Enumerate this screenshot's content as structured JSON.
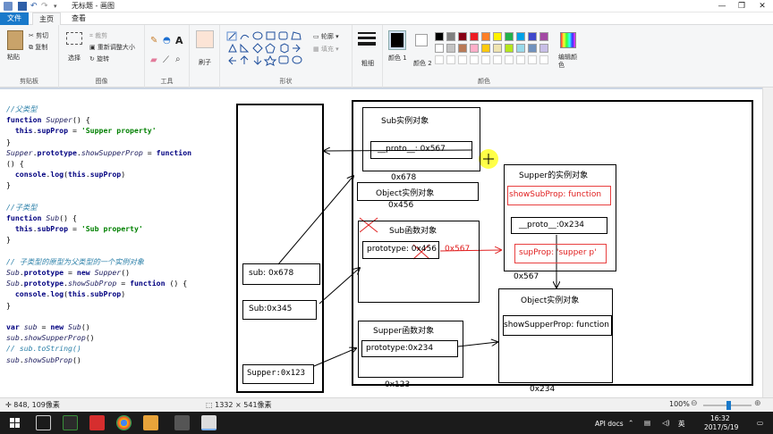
{
  "window": {
    "title": "无标题 - 画图",
    "min_glyph": "—",
    "max_glyph": "❐",
    "close_glyph": "✕"
  },
  "tabs": [
    "文件",
    "主页",
    "查看"
  ],
  "ribbon": {
    "clipboard": {
      "paste": "粘贴",
      "cut": "剪切",
      "copy": "复制",
      "label": "剪贴板"
    },
    "image": {
      "select": "选择",
      "crop": "裁剪",
      "resize": "重新调整大小",
      "rotate": "旋转",
      "label": "图像"
    },
    "tools": {
      "label": "工具"
    },
    "brushes": {
      "label": "刷子"
    },
    "shapes": {
      "outline": "轮廓",
      "fill": "填充",
      "label": "形状"
    },
    "size": {
      "label": "粗细"
    },
    "colors": {
      "color1": "颜色 1",
      "color2": "颜色 2",
      "edit": "编辑颜色",
      "label": "颜色",
      "palette_row1": [
        "#000000",
        "#7f7f7f",
        "#880015",
        "#ed1c24",
        "#ff7f27",
        "#fff200",
        "#22b14c",
        "#00a2e8",
        "#3f48cc",
        "#a349a4"
      ],
      "palette_row2": [
        "#ffffff",
        "#c3c3c3",
        "#b97a57",
        "#ffaec9",
        "#ffc90e",
        "#efe4b0",
        "#b5e61d",
        "#99d9ea",
        "#7092be",
        "#c8bfe7"
      ]
    }
  },
  "code": {
    "lines": [
      [
        [
          "cm",
          "//父类型"
        ]
      ],
      [
        [
          "kw",
          "function "
        ],
        [
          "fn",
          "Supper"
        ],
        [
          "plain",
          "() {"
        ]
      ],
      [
        [
          "plain",
          "  "
        ],
        [
          "kw",
          "this"
        ],
        [
          "plain",
          "."
        ],
        [
          "kw",
          "supProp"
        ],
        [
          "plain",
          " = "
        ],
        [
          "str",
          "'Supper property'"
        ]
      ],
      [
        [
          "plain",
          "}"
        ]
      ],
      [
        [
          "fn",
          "Supper"
        ],
        [
          "plain",
          "."
        ],
        [
          "kw",
          "prototype"
        ],
        [
          "plain",
          "."
        ],
        [
          "fn",
          "showSupperProp"
        ],
        [
          "plain",
          " = "
        ],
        [
          "kw",
          "function"
        ]
      ],
      [
        [
          "plain",
          "() {"
        ]
      ],
      [
        [
          "plain",
          "  "
        ],
        [
          "kw",
          "console"
        ],
        [
          "plain",
          "."
        ],
        [
          "kw",
          "log"
        ],
        [
          "plain",
          "("
        ],
        [
          "kw",
          "this"
        ],
        [
          "plain",
          "."
        ],
        [
          "kw",
          "supProp"
        ],
        [
          "plain",
          ")"
        ]
      ],
      [
        [
          "plain",
          "}"
        ]
      ],
      [
        [
          "plain",
          ""
        ]
      ],
      [
        [
          "cm",
          "//子类型"
        ]
      ],
      [
        [
          "kw",
          "function "
        ],
        [
          "fn",
          "Sub"
        ],
        [
          "plain",
          "() {"
        ]
      ],
      [
        [
          "plain",
          "  "
        ],
        [
          "kw",
          "this"
        ],
        [
          "plain",
          "."
        ],
        [
          "kw",
          "subProp"
        ],
        [
          "plain",
          " = "
        ],
        [
          "str",
          "'Sub property'"
        ]
      ],
      [
        [
          "plain",
          "}"
        ]
      ],
      [
        [
          "plain",
          ""
        ]
      ],
      [
        [
          "cm",
          "// 子类型的原型为父类型的一个实例对象"
        ]
      ],
      [
        [
          "fn",
          "Sub"
        ],
        [
          "plain",
          "."
        ],
        [
          "kw",
          "prototype"
        ],
        [
          "plain",
          " = "
        ],
        [
          "kw",
          "new "
        ],
        [
          "fn",
          "Supper"
        ],
        [
          "plain",
          "()"
        ]
      ],
      [
        [
          "fn",
          "Sub"
        ],
        [
          "plain",
          "."
        ],
        [
          "kw",
          "prototype"
        ],
        [
          "plain",
          "."
        ],
        [
          "fn",
          "showSubProp"
        ],
        [
          "plain",
          " = "
        ],
        [
          "kw",
          "function"
        ],
        [
          "plain",
          " () {"
        ]
      ],
      [
        [
          "plain",
          "  "
        ],
        [
          "kw",
          "console"
        ],
        [
          "plain",
          "."
        ],
        [
          "kw",
          "log"
        ],
        [
          "plain",
          "("
        ],
        [
          "kw",
          "this"
        ],
        [
          "plain",
          "."
        ],
        [
          "kw",
          "subProp"
        ],
        [
          "plain",
          ")"
        ]
      ],
      [
        [
          "plain",
          "}"
        ]
      ],
      [
        [
          "plain",
          ""
        ]
      ],
      [
        [
          "kw",
          "var "
        ],
        [
          "fn",
          "sub"
        ],
        [
          "plain",
          " = "
        ],
        [
          "kw",
          "new "
        ],
        [
          "fn",
          "Sub"
        ],
        [
          "plain",
          "()"
        ]
      ],
      [
        [
          "fn",
          "sub"
        ],
        [
          "plain",
          "."
        ],
        [
          "fn",
          "showSupperProp"
        ],
        [
          "plain",
          "()"
        ]
      ],
      [
        [
          "cm",
          "// sub.toString()"
        ]
      ],
      [
        [
          "fn",
          "sub"
        ],
        [
          "plain",
          "."
        ],
        [
          "fn",
          "showSubProp"
        ],
        [
          "plain",
          "()"
        ]
      ]
    ]
  },
  "diagram": {
    "sub_instance_title": "Sub实例对象",
    "sub_instance_proto": "__proto__: 0x567",
    "addr_678": "0x678",
    "object_instance_1": "Object实例对象",
    "addr_456": "0x456",
    "sub_func_title": "Sub函数对象",
    "sub_func_prototype": "prototype: 0x456",
    "red_567": "0x567",
    "supper_instance_title": "Supper的实例对象",
    "supper_instance_showsub": "showSubProp: function",
    "supper_instance_proto": "__proto__:0x234",
    "supper_instance_supprop": "supProp: 'supper p'",
    "addr_567": "0x567",
    "object_instance_2": "Object实例对象",
    "object_showsupper": "showSupperProp: function",
    "addr_234": "0x234",
    "supper_func_title": "Supper函数对象",
    "supper_func_prototype": "prototype:0x234",
    "addr_123": "0x123",
    "var_sub": "sub: 0x678",
    "var_Sub": "Sub:0x345",
    "var_Supper": "Supper:0x123"
  },
  "status": {
    "cursor": "848, 109像素",
    "size": "1332 × 541像素",
    "zoom": "100%"
  },
  "taskbar": {
    "api": "API docs",
    "ime": "英",
    "time": "16:32",
    "date": "2017/5/19"
  }
}
